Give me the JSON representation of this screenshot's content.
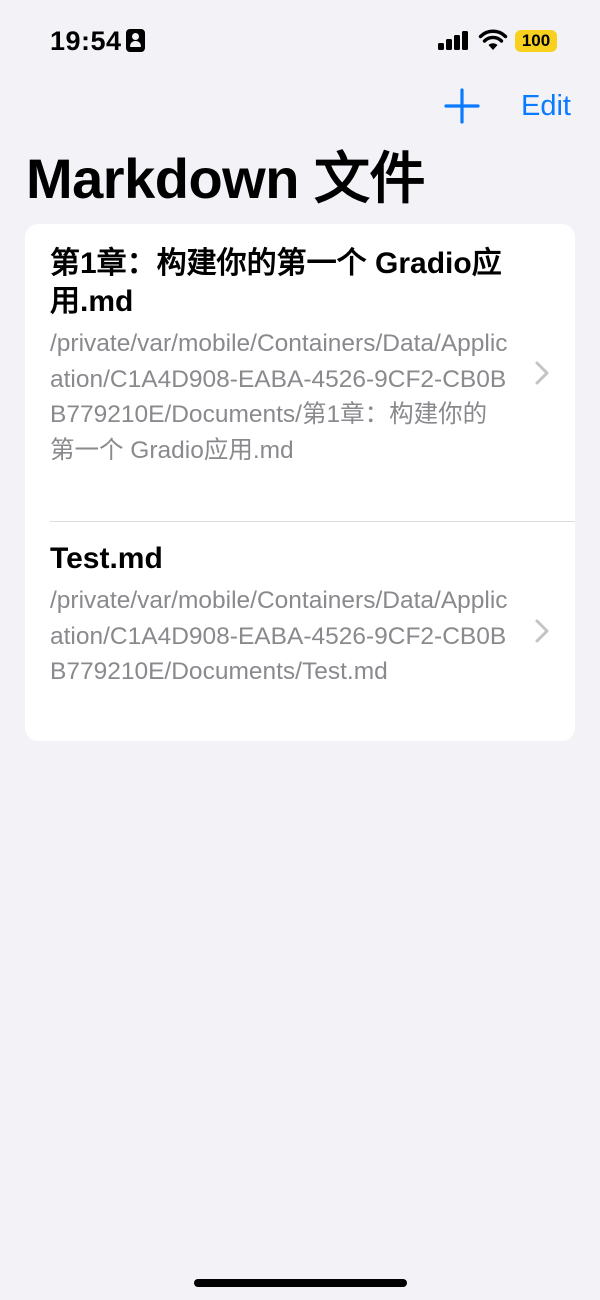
{
  "status_bar": {
    "time": "19:54",
    "battery": "100",
    "battery_color": "#f7d11e"
  },
  "nav": {
    "edit_label": "Edit",
    "accent_color": "#0a7aff"
  },
  "page_title": "Markdown 文件",
  "files": [
    {
      "name": "第1章：构建你的第一个 Gradio应用.md",
      "path": "/private/var/mobile/Containers/Data/Application/C1A4D908-EABA-4526-9CF2-CB0BB779210E/Documents/第1章：构建你的第一个 Gradio应用.md"
    },
    {
      "name": "Test.md",
      "path": "/private/var/mobile/Containers/Data/Application/C1A4D908-EABA-4526-9CF2-CB0BB779210E/Documents/Test.md"
    }
  ]
}
